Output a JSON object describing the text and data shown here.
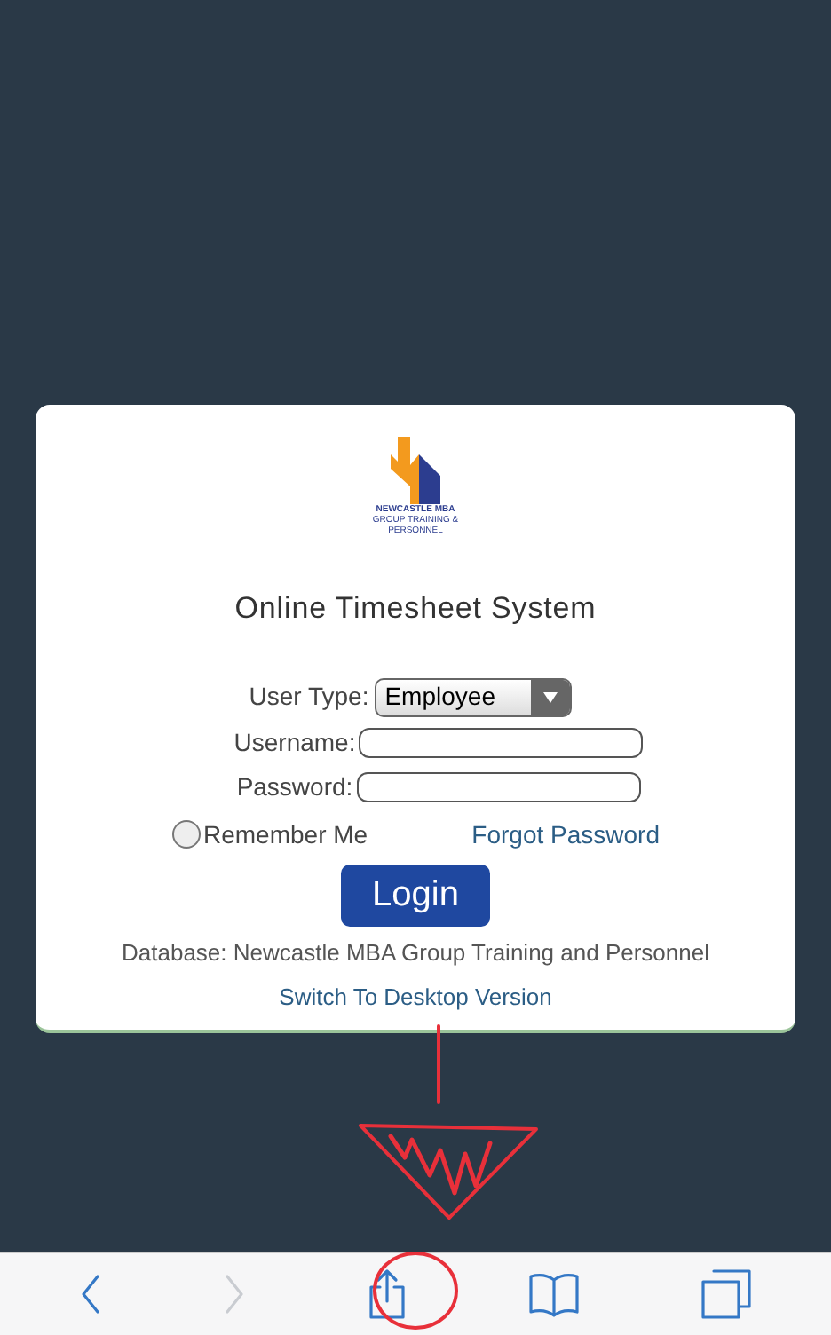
{
  "logo": {
    "lines": [
      "NEWCASTLE MBA",
      "GROUP TRAINING &",
      "PERSONNEL"
    ]
  },
  "title": "Online Timesheet System",
  "form": {
    "user_type": {
      "label": "User Type:",
      "value": "Employee"
    },
    "username": {
      "label": "Username:"
    },
    "password": {
      "label": "Password:"
    },
    "remember": {
      "label": "Remember Me",
      "checked": false
    },
    "forgot_link": "Forgot Password",
    "login_button": "Login"
  },
  "database": "Database: Newcastle MBA Group Training and Personnel",
  "desktop_link": "Switch To Desktop Version",
  "toolbar": [
    {
      "kind": "back",
      "disabled": false
    },
    {
      "kind": "forward",
      "disabled": true
    },
    {
      "kind": "share",
      "disabled": false
    },
    {
      "kind": "bookmarks",
      "disabled": false
    },
    {
      "kind": "tabs",
      "disabled": false
    }
  ]
}
